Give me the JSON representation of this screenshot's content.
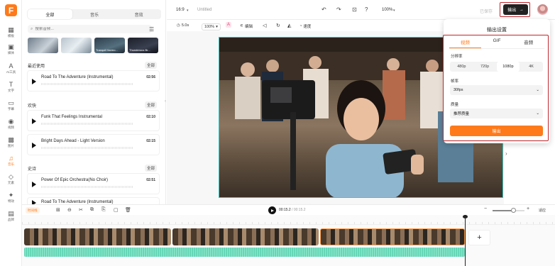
{
  "rail": {
    "items": [
      {
        "label": "模板",
        "icon": "template-icon"
      },
      {
        "label": "媒体",
        "icon": "media-icon"
      },
      {
        "label": "AI工具",
        "icon": "ai-tools-icon"
      },
      {
        "label": "文字",
        "icon": "text-icon"
      },
      {
        "label": "字幕",
        "icon": "subtitles-icon"
      },
      {
        "label": "视频",
        "icon": "video-icon"
      },
      {
        "label": "图片",
        "icon": "image-icon"
      },
      {
        "label": "音乐",
        "icon": "music-icon"
      },
      {
        "label": "元素",
        "icon": "elements-icon"
      },
      {
        "label": "特效",
        "icon": "effects-icon"
      },
      {
        "label": "品牌",
        "icon": "brand-icon"
      }
    ]
  },
  "panel": {
    "tabs": [
      "全部",
      "音乐",
      "音效"
    ],
    "search_placeholder": "搜索音频...",
    "thumbnails": [
      "",
      "",
      "Tranquil Harmo...",
      "Thunderous Br..."
    ],
    "sections": [
      {
        "title": "最近使用",
        "all": "全部",
        "tracks": [
          {
            "name": "Road To The Adventure (Instrumental)",
            "duration": "02:56"
          }
        ]
      },
      {
        "title": "欢快",
        "all": "全部",
        "tracks": [
          {
            "name": "Funk That Feelings Instrumental",
            "duration": "02:10"
          },
          {
            "name": "Bright Days Ahead - Light Version",
            "duration": "02:15"
          }
        ]
      },
      {
        "title": "史诗",
        "all": "全部",
        "tracks": [
          {
            "name": "Power Of Epic Orchestra(No Choir)",
            "duration": "02:51"
          },
          {
            "name": "Road To The Adventure (Instrumental)",
            "duration": ""
          }
        ]
      }
    ]
  },
  "topbar": {
    "ratio": "16:9",
    "title": "Untitled",
    "zoom": "100%",
    "saved": "已保存",
    "export": "输出"
  },
  "editbar": {
    "duration": "5.0s",
    "scale": "100%",
    "edit": "编辑",
    "speed": "速度"
  },
  "export_popup": {
    "title": "输出设置",
    "tabs": [
      "视频",
      "GIF",
      "音频"
    ],
    "resolution_label": "分辨率",
    "resolutions": [
      "480p",
      "720p",
      "1080p",
      "4K"
    ],
    "selected_resolution": "1080p",
    "framerate_label": "帧率",
    "framerate": "30fps",
    "quality_label": "质量",
    "quality": "推荐质量",
    "export_button": "输出"
  },
  "timeline_bar": {
    "smart": "时间线",
    "current": "00:15.2",
    "total": "/ 00:15.2",
    "fit": "适应"
  },
  "colors": {
    "accent": "#ff7a1a",
    "highlight": "#c0262c",
    "audio": "#6edbbb",
    "preview_border": "#3cc6c0"
  }
}
